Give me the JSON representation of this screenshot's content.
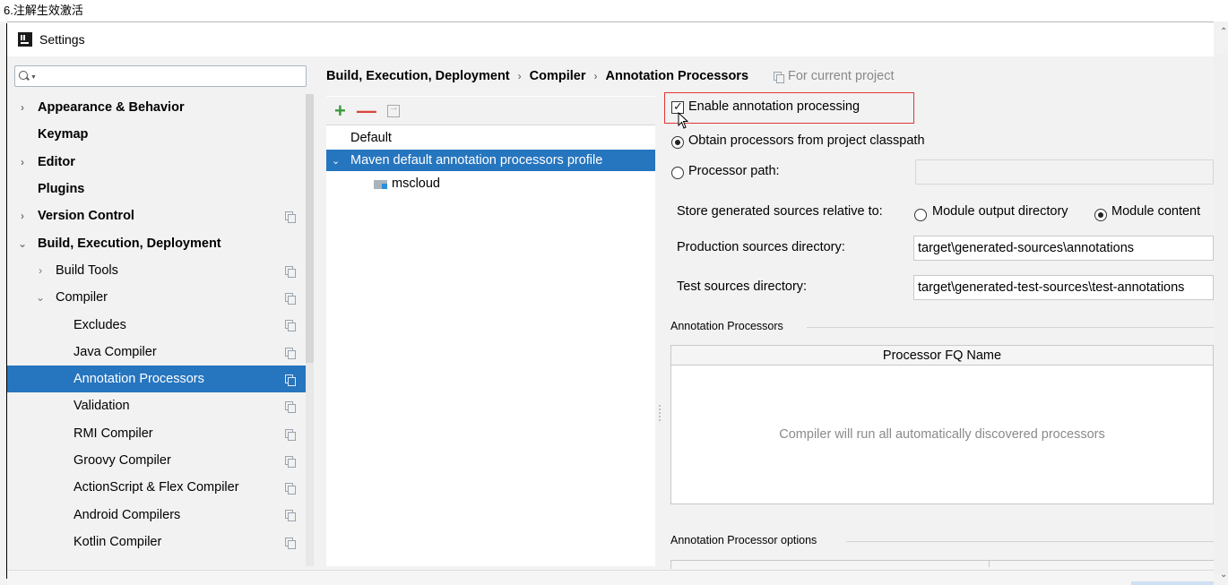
{
  "caption": "6.注解生效激活",
  "window": {
    "title": "Settings"
  },
  "search": {
    "placeholder": ""
  },
  "sidebar": {
    "items": [
      {
        "label": "Appearance & Behavior",
        "arrow": "›",
        "bold": true
      },
      {
        "label": "Keymap",
        "arrow": "",
        "bold": true
      },
      {
        "label": "Editor",
        "arrow": "›",
        "bold": true
      },
      {
        "label": "Plugins",
        "arrow": "",
        "bold": true
      },
      {
        "label": "Version Control",
        "arrow": "›",
        "bold": true
      },
      {
        "label": "Build, Execution, Deployment",
        "arrow": "⌄",
        "bold": true
      },
      {
        "label": "Build Tools",
        "arrow": "›",
        "bold": false
      },
      {
        "label": "Compiler",
        "arrow": "⌄",
        "bold": false
      },
      {
        "label": "Excludes",
        "arrow": "",
        "bold": false
      },
      {
        "label": "Java Compiler",
        "arrow": "",
        "bold": false
      },
      {
        "label": "Annotation Processors",
        "arrow": "",
        "bold": false,
        "selected": true
      },
      {
        "label": "Validation",
        "arrow": "",
        "bold": false
      },
      {
        "label": "RMI Compiler",
        "arrow": "",
        "bold": false
      },
      {
        "label": "Groovy Compiler",
        "arrow": "",
        "bold": false
      },
      {
        "label": "ActionScript & Flex Compiler",
        "arrow": "",
        "bold": false
      },
      {
        "label": "Android Compilers",
        "arrow": "",
        "bold": false
      },
      {
        "label": "Kotlin Compiler",
        "arrow": "",
        "bold": false
      }
    ]
  },
  "breadcrumb": {
    "items": [
      "Build, Execution, Deployment",
      "Compiler",
      "Annotation Processors"
    ],
    "separator": "›",
    "scope": "For current project"
  },
  "profiles": {
    "toolbar": {
      "add": "+",
      "remove": "—"
    },
    "rows": [
      {
        "label": "Default",
        "arrow": ""
      },
      {
        "label": "Maven default annotation processors profile",
        "arrow": "⌄",
        "selected": true
      },
      {
        "label": "mscloud",
        "arrow": ""
      }
    ]
  },
  "options": {
    "enable_label": "Enable annotation processing",
    "enable_checked": true,
    "obtain_label": "Obtain processors from project classpath",
    "processor_path_label": "Processor path:",
    "processor_path_value": "",
    "store_label": "Store generated sources relative to:",
    "module_output_label": "Module output directory",
    "module_content_label": "Module content",
    "production_label": "Production sources directory:",
    "production_value": "target\\generated-sources\\annotations",
    "test_label": "Test sources directory:",
    "test_value": "target\\generated-test-sources\\test-annotations"
  },
  "processors_section": {
    "title": "Annotation Processors",
    "column": "Processor FQ Name",
    "empty_text": "Compiler will run all automatically discovered processors"
  },
  "options_section": {
    "title": "Annotation Processor options"
  },
  "colors": {
    "selection": "#2675bf",
    "highlight": "#e03636",
    "add": "#3c9b3c",
    "remove": "#d9453a"
  }
}
